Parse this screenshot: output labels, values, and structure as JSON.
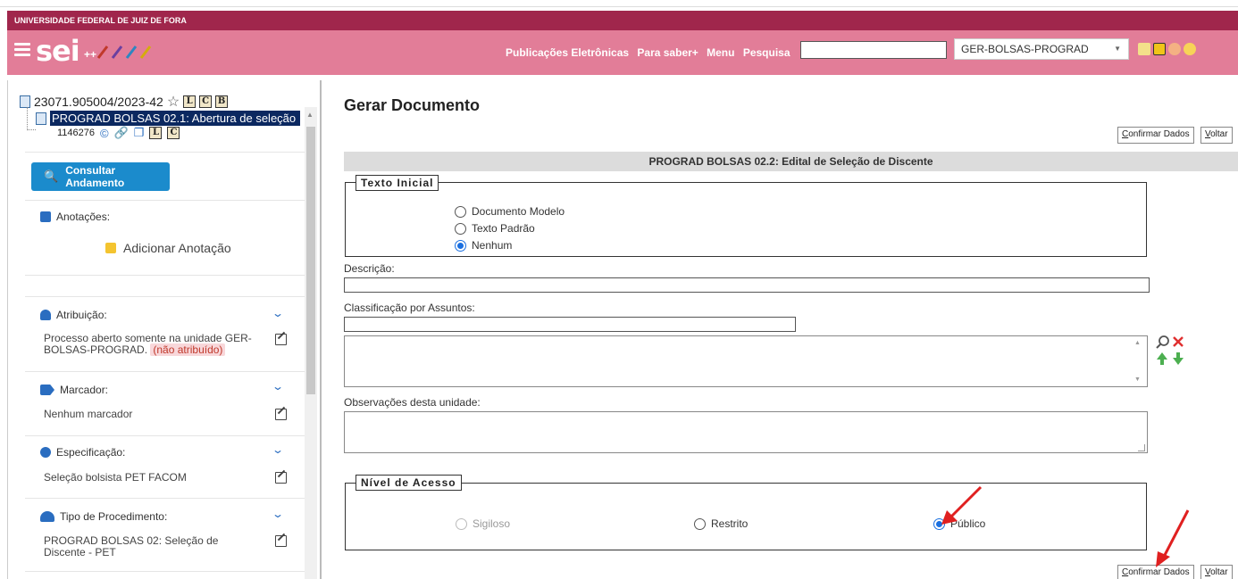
{
  "header": {
    "university": "UNIVERSIDADE FEDERAL DE JUIZ DE FORA",
    "logo": "sei",
    "logo_suffix": "++",
    "nav": [
      "Publicações Eletrônicas",
      "Para saber+",
      "Menu",
      "Pesquisa"
    ],
    "search_value": "",
    "unit": "GER-BOLSAS-PROGRAD",
    "colors": {
      "top": "#a0264c",
      "bar": "#e27d98"
    }
  },
  "tree": {
    "process": "23071.905004/2023-42",
    "process_buttons": [
      "L",
      "C",
      "B"
    ],
    "doc_label": "PROGRAD BOLSAS 02.1: Abertura de seleção",
    "doc_number": "1146276",
    "doc_buttons": [
      "L",
      "C"
    ]
  },
  "sidebar": {
    "andamento_button": "Consultar Andamento",
    "anotacoes_title": "Anotações:",
    "adicionar_anotacao": "Adicionar Anotação",
    "atribuicao_title": "Atribuição:",
    "atribuicao_text": "Processo aberto somente na unidade GER-BOLSAS-PROGRAD.",
    "atribuicao_badge": "(não atribuído)",
    "marcador_title": "Marcador:",
    "marcador_text": "Nenhum marcador",
    "especificacao_title": "Especificação:",
    "especificacao_text": "Seleção bolsista PET FACOM",
    "tipo_title": "Tipo de Procedimento:",
    "tipo_text": "PROGRAD BOLSAS 02: Seleção de Discente - PET"
  },
  "main": {
    "title": "Gerar Documento",
    "confirm_label": "Confirmar Dados",
    "back_label": "Voltar",
    "doc_type": "PROGRAD BOLSAS 02.2: Edital de Seleção de Discente",
    "texto_inicial": {
      "legend": "Texto Inicial",
      "options": [
        "Documento Modelo",
        "Texto Padrão",
        "Nenhum"
      ],
      "selected": "Nenhum"
    },
    "descricao_label": "Descrição:",
    "descricao_value": "",
    "classificacao_label": "Classificação por Assuntos:",
    "observacoes_label": "Observações desta unidade:",
    "nivel_acesso": {
      "legend": "Nível de Acesso",
      "options": [
        "Sigiloso",
        "Restrito",
        "Público"
      ],
      "selected": "Público"
    }
  }
}
